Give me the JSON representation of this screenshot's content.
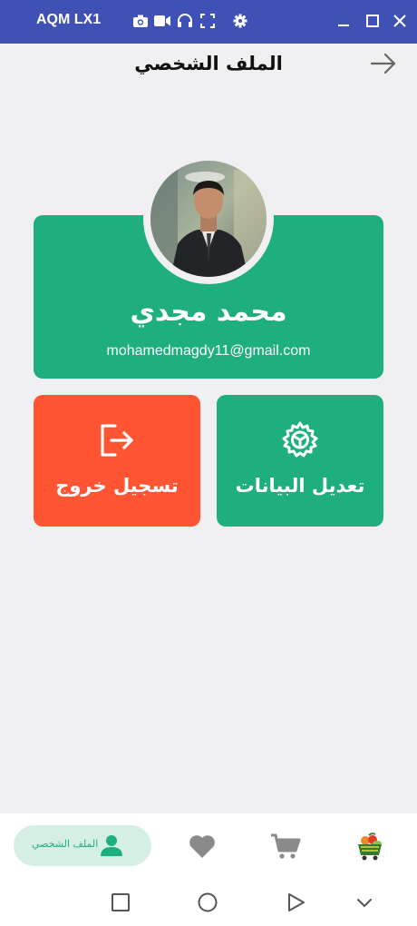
{
  "emulator": {
    "device_name": "AQM LX1",
    "icons": [
      "camera-icon",
      "video-icon",
      "headphones-icon",
      "fullscreen-icon",
      "settings-icon",
      "minimize-icon",
      "maximize-icon",
      "close-icon"
    ]
  },
  "appbar": {
    "title": "الملف الشخصي",
    "back_icon": "arrow-right-icon"
  },
  "profile": {
    "name": "محمد مجدي",
    "email": "mohamedmagdy11@gmail.com"
  },
  "actions": {
    "edit": {
      "label": "تعديل البيانات",
      "icon": "gear-icon"
    },
    "logout": {
      "label": "تسجيل خروج",
      "icon": "logout-icon"
    }
  },
  "bottom_nav": {
    "active_label": "الملف الشخصي",
    "items": [
      "person-icon",
      "heart-icon",
      "cart-icon",
      "grocery-basket-icon"
    ]
  },
  "system_nav": [
    "square-icon",
    "circle-icon",
    "triangle-icon",
    "chevron-down-icon"
  ],
  "colors": {
    "accent_green": "#1fae7e",
    "logout_red": "#ff5533",
    "titlebar_blue": "#3f51b5",
    "background": "#f0eff1"
  }
}
